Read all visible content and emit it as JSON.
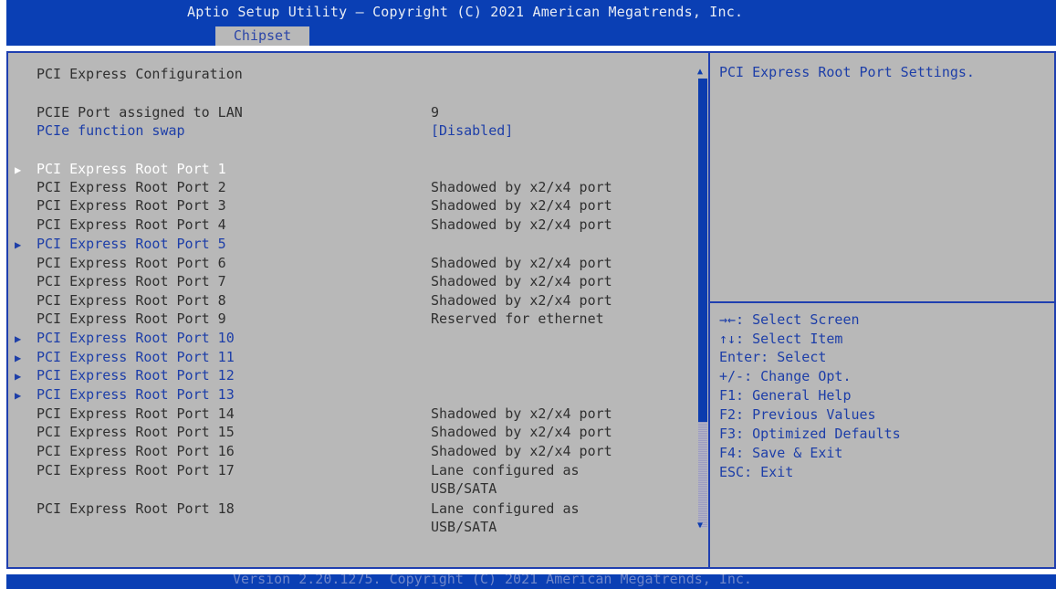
{
  "header": {
    "title": "Aptio Setup Utility – Copyright (C) 2021 American Megatrends, Inc.",
    "tabs": [
      {
        "label": "Chipset",
        "active": true
      }
    ]
  },
  "main": {
    "section_title": "PCI Express Configuration",
    "lan_port": {
      "label": "PCIE Port assigned to LAN",
      "value": "9"
    },
    "function_swap": {
      "label": "PCIe function swap",
      "value": "[Disabled]"
    },
    "root_ports": [
      {
        "label": "PCI Express Root Port 1",
        "value": "",
        "submenu": true,
        "selected": true
      },
      {
        "label": "PCI Express Root Port 2",
        "value": "Shadowed by x2/x4 port"
      },
      {
        "label": "PCI Express Root Port 3",
        "value": "Shadowed by x2/x4 port"
      },
      {
        "label": "PCI Express Root Port 4",
        "value": "Shadowed by x2/x4 port"
      },
      {
        "label": "PCI Express Root Port 5",
        "value": "",
        "submenu": true
      },
      {
        "label": "PCI Express Root Port 6",
        "value": "Shadowed by x2/x4 port"
      },
      {
        "label": "PCI Express Root Port 7",
        "value": "Shadowed by x2/x4 port"
      },
      {
        "label": "PCI Express Root Port 8",
        "value": "Shadowed by x2/x4 port"
      },
      {
        "label": "PCI Express Root Port 9",
        "value": "Reserved for ethernet"
      },
      {
        "label": "PCI Express Root Port 10",
        "value": "",
        "submenu": true
      },
      {
        "label": "PCI Express Root Port 11",
        "value": "",
        "submenu": true
      },
      {
        "label": "PCI Express Root Port 12",
        "value": "",
        "submenu": true
      },
      {
        "label": "PCI Express Root Port 13",
        "value": "",
        "submenu": true
      },
      {
        "label": "PCI Express Root Port 14",
        "value": "Shadowed by x2/x4 port"
      },
      {
        "label": "PCI Express Root Port 15",
        "value": "Shadowed by x2/x4 port"
      },
      {
        "label": "PCI Express Root Port 16",
        "value": "Shadowed by x2/x4 port"
      },
      {
        "label": "PCI Express Root Port 17",
        "value": "Lane configured as",
        "value2": "USB/SATA"
      },
      {
        "label": "PCI Express Root Port 18",
        "value": "Lane configured as",
        "value2": "USB/SATA"
      }
    ]
  },
  "help": {
    "description": "PCI Express Root Port Settings.",
    "keys": [
      "→←: Select Screen",
      "↑↓: Select Item",
      "Enter: Select",
      "+/-: Change Opt.",
      "F1: General Help",
      "F2: Previous Values",
      "F3: Optimized Defaults",
      "F4: Save & Exit",
      "ESC: Exit"
    ]
  },
  "footer": {
    "version": "Version 2.20.1275. Copyright (C) 2021 American Megatrends, Inc."
  },
  "colors": {
    "header_bg": "#0a3fb4",
    "panel_bg": "#b8b8b8",
    "item_text": "#303030",
    "selectable_text": "#1d3ea8",
    "selected_text": "#ffffff"
  }
}
